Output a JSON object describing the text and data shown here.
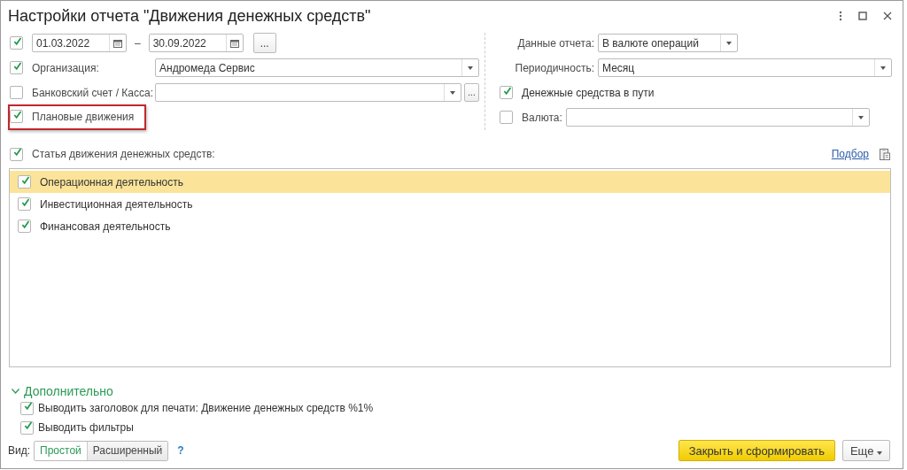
{
  "window": {
    "title": "Настройки отчета \"Движения денежных средств\""
  },
  "period": {
    "checked": true,
    "start": "01.03.2022",
    "separator": "–",
    "end": "30.09.2022",
    "more_button": "..."
  },
  "left_fields": [
    {
      "kind": "select",
      "checked": true,
      "label": "Организация:",
      "value": "Андромеда Сервис"
    },
    {
      "kind": "select_more",
      "checked": false,
      "label": "Банковский счет / Касса:",
      "more_button": "..."
    },
    {
      "kind": "checkbox",
      "checked": true,
      "label": "Плановые движения",
      "highlighted": true
    }
  ],
  "right_fields": [
    {
      "kind": "short_select",
      "label": "Данные отчета:",
      "value": "В валюте операций"
    },
    {
      "kind": "select",
      "label": "Периодичность:",
      "value": "Месяц"
    },
    {
      "kind": "checkbox",
      "checked": true,
      "label": "Денежные средства в пути"
    },
    {
      "kind": "check_select",
      "checked": false,
      "label": "Валюта:"
    }
  ],
  "articles": {
    "checked": true,
    "label": "Статья движения денежных средств:",
    "pick_link": "Подбор",
    "items": [
      {
        "label": "Операционная деятельность",
        "checked": true,
        "selected": true
      },
      {
        "label": "Инвестиционная деятельность",
        "checked": true,
        "selected": false
      },
      {
        "label": "Финансовая деятельность",
        "checked": true,
        "selected": false
      }
    ]
  },
  "additional": {
    "title": "Дополнительно",
    "expanded": true,
    "options": [
      {
        "label": "Выводить заголовок для печати: Движение денежных средств %1%",
        "checked": true
      },
      {
        "label": "Выводить фильтры",
        "checked": true
      }
    ]
  },
  "view": {
    "label": "Вид:",
    "modes": [
      {
        "label": "Простой",
        "selected": true
      },
      {
        "label": "Расширенный",
        "selected": false
      }
    ],
    "help": "?"
  },
  "buttons": {
    "primary": "Закрыть и сформировать",
    "more": "Еще"
  }
}
